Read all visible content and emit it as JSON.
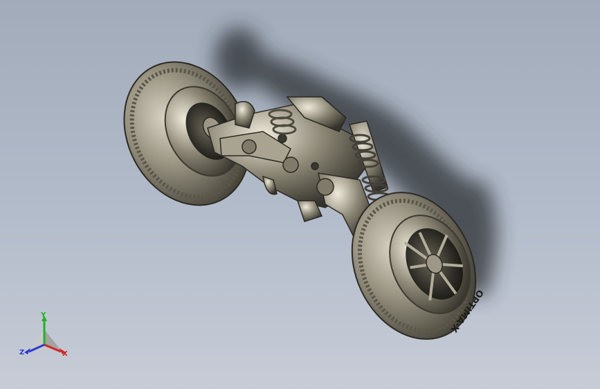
{
  "triad": {
    "x_label": "X",
    "y_label": "Y",
    "z_label": "Z",
    "x_color": "#d02525",
    "y_color": "#25b025",
    "z_color": "#2a3ad0"
  },
  "wheel": {
    "sidewall_text": "OPTIMA-X"
  },
  "scene": {
    "background_top": "#a1abba",
    "background_bottom": "#c7ccd6",
    "part_color": "#8f8a78"
  }
}
